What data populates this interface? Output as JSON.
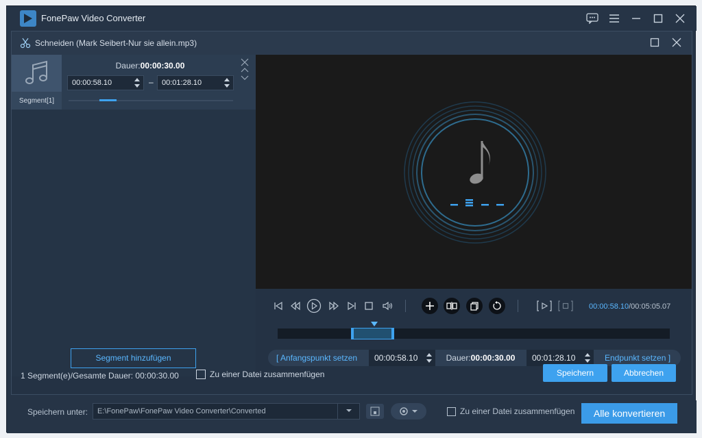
{
  "app": {
    "title": "FonePaw Video Converter",
    "accent": "#3ea2ef"
  },
  "background": {
    "save_label": "Speichern unter:",
    "path": "E:\\FonePaw\\FonePaw Video Converter\\Converted",
    "merge_label": "Zu einer Datei zusammenfügen",
    "convert_all": "Alle konvertieren"
  },
  "dialog": {
    "title": "Schneiden (Mark Seibert-Nur sie allein.mp3)",
    "segment": {
      "label": "Segment[1]",
      "duration_prefix": "Dauer:",
      "duration_value": "00:00:30.00",
      "start": "00:00:58.10",
      "end": "00:01:28.10",
      "dash": "–",
      "progress": 0.21
    },
    "add_segment": "Segment hinzufügen",
    "player": {
      "current_time": "00:00:58.10",
      "total_time": "/00:05:05.07"
    },
    "trim_bar": {
      "set_start": "Anfangspunkt setzen",
      "start_time": "00:00:58.10",
      "duration_prefix": "Dauer:",
      "duration_value": "00:00:30.00",
      "end_time": "00:01:28.10",
      "set_end": "Endpunkt setzen"
    },
    "footer": {
      "info": "1 Segment(e)/Gesamte Dauer: 00:00:30.00",
      "merge_label": "Zu einer Datei zusammenfügen",
      "save": "Speichern",
      "cancel": "Abbrechen"
    }
  }
}
